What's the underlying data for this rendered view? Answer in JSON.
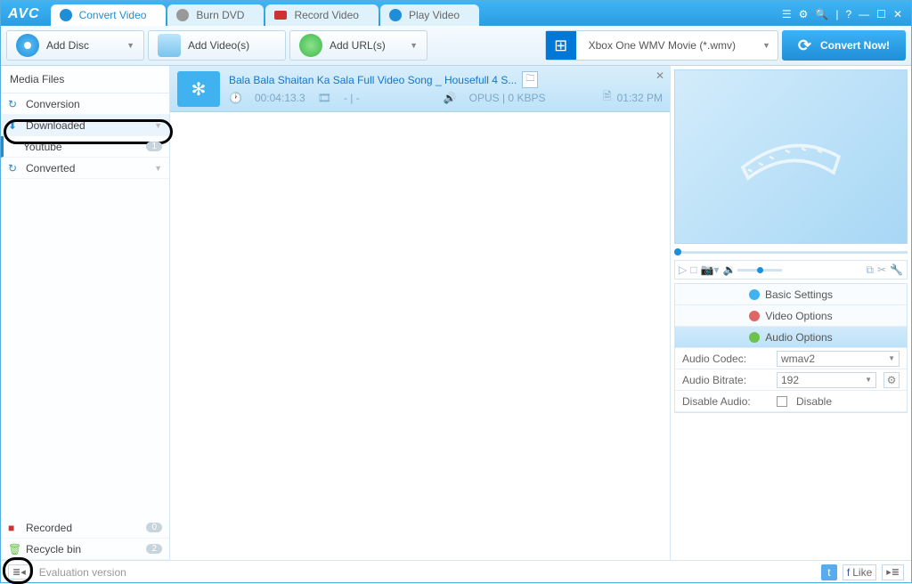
{
  "app": {
    "logo": "AVC"
  },
  "tabs": [
    {
      "label": "Convert Video",
      "active": true
    },
    {
      "label": "Burn DVD"
    },
    {
      "label": "Record Video"
    },
    {
      "label": "Play Video"
    }
  ],
  "toolbar": {
    "addDisc": "Add Disc",
    "addVideos": "Add Video(s)",
    "addUrls": "Add URL(s)",
    "format": "Xbox One WMV Movie (*.wmv)",
    "convert": "Convert Now!"
  },
  "sidebar": {
    "title": "Media Files",
    "items": {
      "conversion": "Conversion",
      "downloaded": "Downloaded",
      "youtube": "Youtube",
      "youtube_badge": "1",
      "converted": "Converted",
      "recorded": "Recorded",
      "recorded_badge": "0",
      "recycle": "Recycle bin",
      "recycle_badge": "2"
    }
  },
  "media": {
    "title": "Bala Bala Shaitan Ka Sala Full Video Song _ Housefull 4 S...",
    "duration": "00:04:13.3",
    "subinfo": "- | -",
    "audio": "OPUS | 0 KBPS",
    "time": "01:32 PM"
  },
  "panels": {
    "basic": "Basic Settings",
    "video": "Video Options",
    "audio": "Audio Options"
  },
  "audioOptions": {
    "codecLabel": "Audio Codec:",
    "codecValue": "wmav2",
    "bitrateLabel": "Audio Bitrate:",
    "bitrateValue": "192",
    "disableLabel": "Disable Audio:",
    "disableChk": "Disable"
  },
  "status": {
    "version": "Evaluation version",
    "like": "Like"
  }
}
